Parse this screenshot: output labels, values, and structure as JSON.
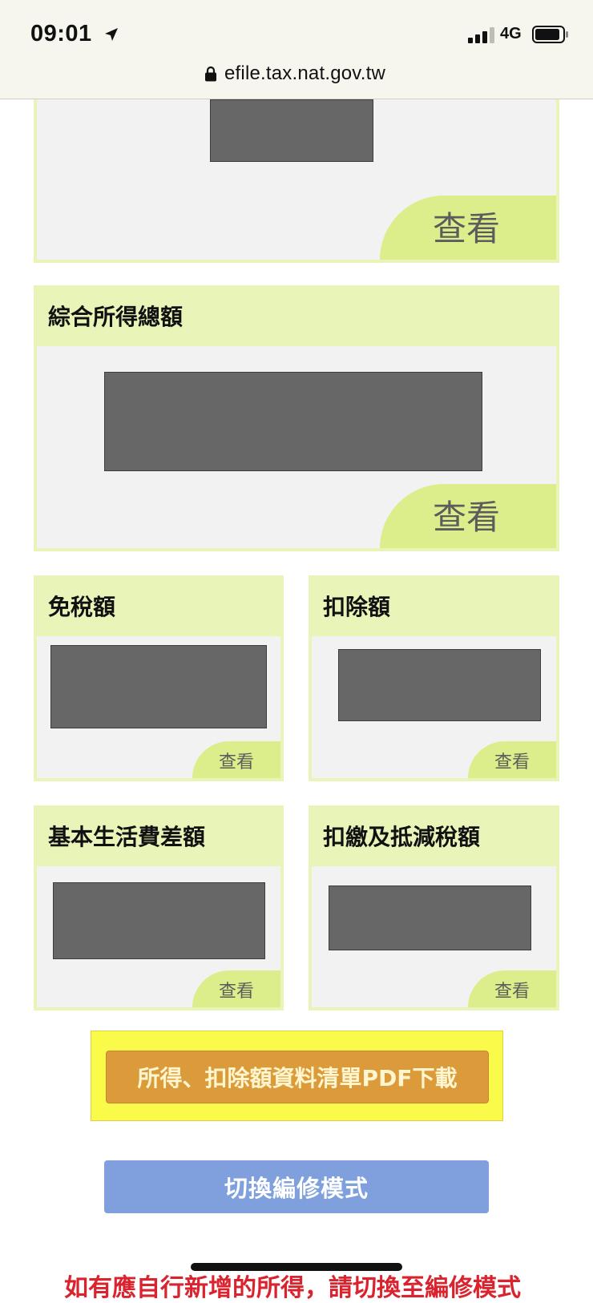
{
  "status_bar": {
    "time": "09:01",
    "network": "4G",
    "location_icon": "location-arrow-icon",
    "signal_icon": "cellular-signal-icon",
    "battery_icon": "battery-icon"
  },
  "browser": {
    "url": "efile.tax.nat.gov.tw",
    "lock_icon": "lock-icon"
  },
  "cards": {
    "top": {
      "view_label": "查看"
    },
    "gross_income": {
      "title": "綜合所得總額",
      "view_label": "查看"
    },
    "exemption": {
      "title": "免稅額",
      "view_label": "查看"
    },
    "deduction": {
      "title": "扣除額",
      "view_label": "查看"
    },
    "basic_living": {
      "title": "基本生活費差額",
      "view_label": "查看"
    },
    "withholding": {
      "title": "扣繳及抵減稅額",
      "view_label": "查看"
    }
  },
  "actions": {
    "pdf_download": "所得、扣除額資料清單PDF下載",
    "switch_edit_mode": "切換編修模式"
  },
  "notice": "如有應自行新增的所得，請切換至編修模式",
  "colors": {
    "card_header": "#e9f4b9",
    "card_body": "#f2f2f2",
    "view_tab": "#dcee8b",
    "redacted_value": "#676767",
    "pdf_highlight": "#fafa4a",
    "pdf_button": "#db9b3a",
    "edit_button": "#7fa0dc",
    "notice_text": "#d9232e"
  }
}
